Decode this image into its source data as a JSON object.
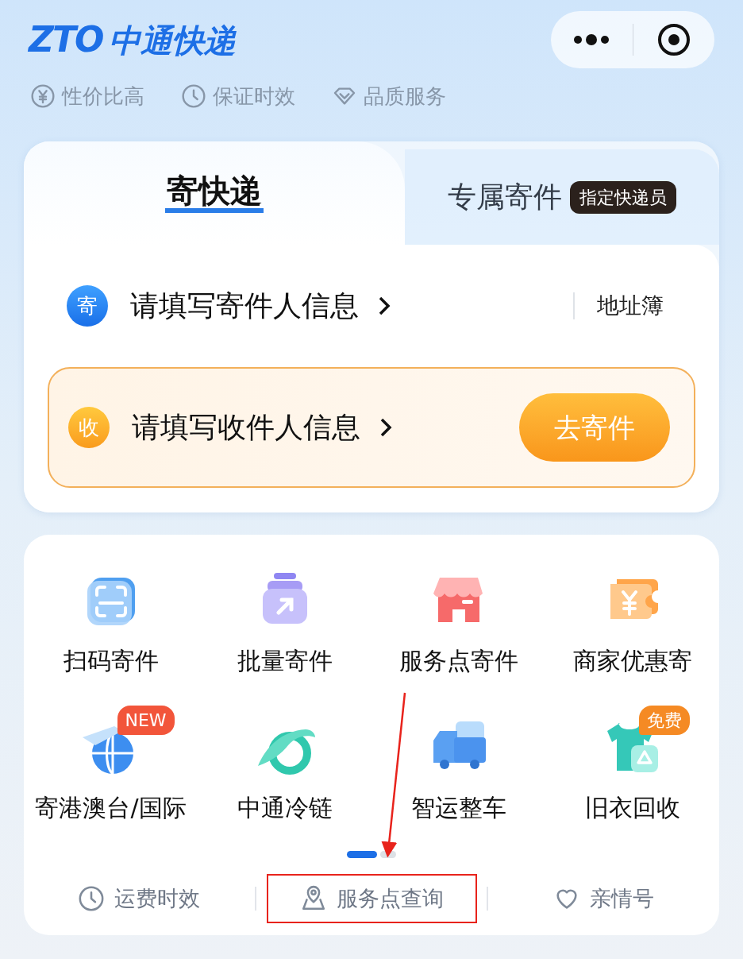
{
  "header": {
    "logo_mark": "ZTO",
    "logo_text": "中通快递"
  },
  "features": [
    {
      "kind": "yuan",
      "label": "性价比高"
    },
    {
      "kind": "clock",
      "label": "保证时效"
    },
    {
      "kind": "diamond",
      "label": "品质服务"
    }
  ],
  "tabs": [
    {
      "label": "寄快递",
      "selected": true
    },
    {
      "label": "专属寄件",
      "badge": "指定快递员",
      "selected": false
    }
  ],
  "sender": {
    "marker": "寄",
    "label": "请填写寄件人信息",
    "link": "地址簿"
  },
  "receiver": {
    "marker": "收",
    "label": "请填写收件人信息",
    "button": "去寄件"
  },
  "services": [
    {
      "kind": "scan",
      "label": "扫码寄件"
    },
    {
      "kind": "batch",
      "label": "批量寄件"
    },
    {
      "kind": "store",
      "label": "服务点寄件"
    },
    {
      "kind": "coupon",
      "label": "商家优惠寄"
    },
    {
      "kind": "globe",
      "label": "寄港澳台/国际",
      "badge": {
        "text": "NEW",
        "color": "#f2553a"
      }
    },
    {
      "kind": "dolphin",
      "label": "中通冷链"
    },
    {
      "kind": "truck",
      "label": "智运整车"
    },
    {
      "kind": "shirt",
      "label": "旧衣回收",
      "badge": {
        "text": "免费",
        "color": "#f58a24"
      }
    }
  ],
  "pager": [
    {
      "selected": true
    },
    {
      "selected": false
    }
  ],
  "bottom_links": [
    {
      "kind": "clock",
      "label": "运费时效",
      "highlighted": false
    },
    {
      "kind": "pin",
      "label": "服务点查询",
      "highlighted": true
    },
    {
      "kind": "heart",
      "label": "亲情号",
      "highlighted": false
    }
  ]
}
